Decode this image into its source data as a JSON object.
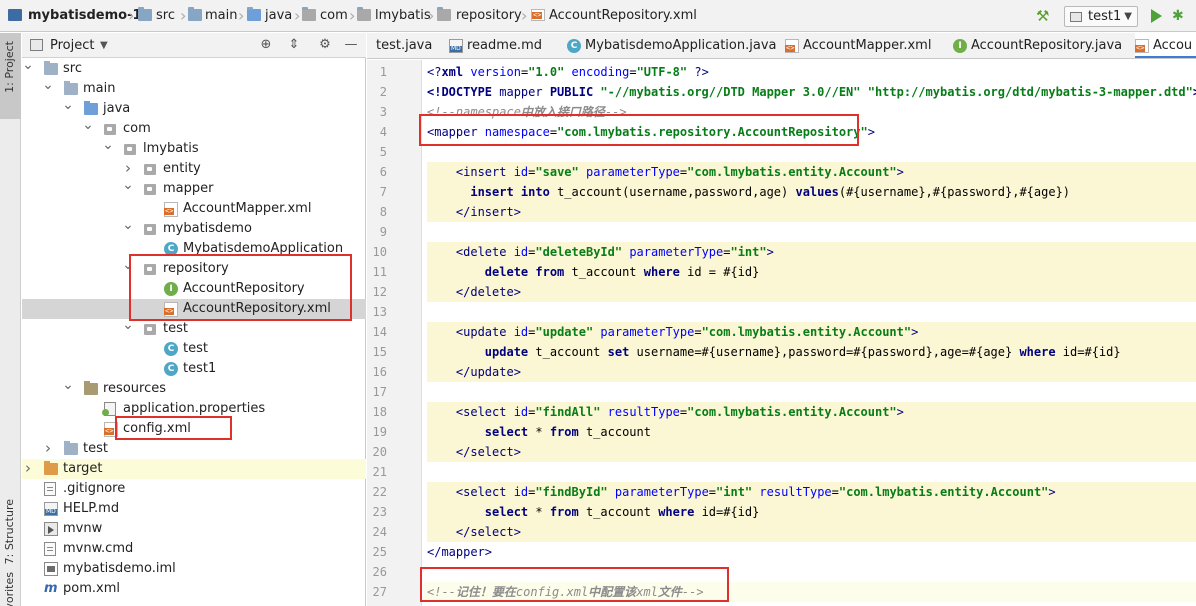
{
  "navbar": {
    "crumbs": [
      "mybatisdemo-1",
      "src",
      "main",
      "java",
      "com",
      "lmybatis",
      "repository",
      "AccountRepository.xml"
    ],
    "run_config": "test1"
  },
  "toolstrip": {
    "project": "1: Project",
    "structure": "7: Structure",
    "favorites": "Favorites"
  },
  "project_panel": {
    "title": "Project",
    "tree": [
      {
        "label": "src",
        "icon": "folder-icon",
        "chevron": "expanded"
      },
      {
        "label": "main",
        "icon": "folder-icon",
        "chevron": "expanded"
      },
      {
        "label": "java",
        "icon": "source-folder-icon",
        "chevron": "expanded"
      },
      {
        "label": "com",
        "icon": "package-icon",
        "chevron": "expanded"
      },
      {
        "label": "lmybatis",
        "icon": "package-icon",
        "chevron": "expanded"
      },
      {
        "label": "entity",
        "icon": "package-icon",
        "chevron": "collapsed"
      },
      {
        "label": "mapper",
        "icon": "package-icon",
        "chevron": "expanded"
      },
      {
        "label": "AccountMapper.xml",
        "icon": "xml-file-icon",
        "chevron": "none"
      },
      {
        "label": "mybatisdemo",
        "icon": "package-icon",
        "chevron": "expanded"
      },
      {
        "label": "MybatisdemoApplication",
        "icon": "class-icon",
        "chevron": "none"
      },
      {
        "label": "repository",
        "icon": "package-icon",
        "chevron": "expanded"
      },
      {
        "label": "AccountRepository",
        "icon": "interface-icon",
        "chevron": "none"
      },
      {
        "label": "AccountRepository.xml",
        "icon": "xml-file-icon",
        "chevron": "none"
      },
      {
        "label": "test",
        "icon": "package-icon",
        "chevron": "expanded"
      },
      {
        "label": "test",
        "icon": "class-icon",
        "chevron": "none"
      },
      {
        "label": "test1",
        "icon": "class-icon",
        "chevron": "none"
      },
      {
        "label": "resources",
        "icon": "resources-folder-icon",
        "chevron": "expanded"
      },
      {
        "label": "application.properties",
        "icon": "properties-file-icon",
        "chevron": "none"
      },
      {
        "label": "config.xml",
        "icon": "xml-file-icon",
        "chevron": "none"
      },
      {
        "label": "test",
        "icon": "folder-icon",
        "chevron": "collapsed"
      },
      {
        "label": "target",
        "icon": "target-folder-icon",
        "chevron": "collapsed"
      },
      {
        "label": ".gitignore",
        "icon": "gitignore-file-icon",
        "chevron": "none"
      },
      {
        "label": "HELP.md",
        "icon": "markdown-file-icon",
        "chevron": "none"
      },
      {
        "label": "mvnw",
        "icon": "script-file-icon",
        "chevron": "none"
      },
      {
        "label": "mvnw.cmd",
        "icon": "text-file-icon",
        "chevron": "none"
      },
      {
        "label": "mybatisdemo.iml",
        "icon": "iml-file-icon",
        "chevron": "none"
      },
      {
        "label": "pom.xml",
        "icon": "maven-icon",
        "chevron": "none"
      }
    ]
  },
  "tabs": [
    {
      "label": "test.java",
      "icon": "class-icon"
    },
    {
      "label": "readme.md",
      "icon": "markdown-file-icon"
    },
    {
      "label": "MybatisdemoApplication.java",
      "icon": "class-icon"
    },
    {
      "label": "AccountMapper.xml",
      "icon": "xml-file-icon"
    },
    {
      "label": "AccountRepository.java",
      "icon": "interface-icon"
    },
    {
      "label": "Accou",
      "icon": "xml-file-icon"
    }
  ],
  "editor": {
    "line_numbers": [
      "1",
      "2",
      "3",
      "4",
      "5",
      "6",
      "7",
      "8",
      "9",
      "10",
      "11",
      "12",
      "13",
      "14",
      "15",
      "16",
      "17",
      "18",
      "19",
      "20",
      "21",
      "22",
      "23",
      "24",
      "25",
      "26",
      "27"
    ],
    "lines": [
      [
        [
          "tag",
          "<?"
        ],
        [
          "kw",
          "xml "
        ],
        [
          "attr",
          "version"
        ],
        [
          "plain",
          "="
        ],
        [
          "val",
          "\"1.0\""
        ],
        [
          "plain",
          " "
        ],
        [
          "attr",
          "encoding"
        ],
        [
          "plain",
          "="
        ],
        [
          "val",
          "\"UTF-8\""
        ],
        [
          "plain",
          " "
        ],
        [
          "tag",
          "?>"
        ]
      ],
      [
        [
          "kw",
          "<!DOCTYPE "
        ],
        [
          "tag",
          "mapper "
        ],
        [
          "kw",
          "PUBLIC "
        ],
        [
          "val",
          "\"-//mybatis.org//DTD Mapper 3.0//EN\""
        ],
        [
          "plain",
          " "
        ],
        [
          "val",
          "\"http://mybatis.org/dtd/mybatis-3-mapper.dtd\""
        ],
        [
          "kw",
          ">"
        ]
      ],
      [
        [
          "cmt",
          "<!--namespace"
        ],
        [
          "cmt-b",
          "中放入接口路径"
        ],
        [
          "cmt",
          "-->"
        ]
      ],
      [
        [
          "tag",
          "<mapper "
        ],
        [
          "attr",
          "namespace"
        ],
        [
          "plain",
          "="
        ],
        [
          "val",
          "\"com.lmybatis.repository.AccountRepository\""
        ],
        [
          "tag",
          ">"
        ]
      ],
      [],
      [
        [
          "plain",
          "    "
        ],
        [
          "tag",
          "<insert "
        ],
        [
          "attr",
          "id"
        ],
        [
          "plain",
          "="
        ],
        [
          "val",
          "\"save\""
        ],
        [
          "plain",
          " "
        ],
        [
          "attr",
          "parameterType"
        ],
        [
          "plain",
          "="
        ],
        [
          "val",
          "\"com.lmybatis.entity.Account\""
        ],
        [
          "tag",
          ">"
        ]
      ],
      [
        [
          "plain",
          "      "
        ],
        [
          "kw",
          "insert into "
        ],
        [
          "plain",
          "t_account(username,password,age) "
        ],
        [
          "kw",
          "values"
        ],
        [
          "plain",
          "(#{username},#{password},#{age})"
        ]
      ],
      [
        [
          "plain",
          "    "
        ],
        [
          "tag",
          "</insert>"
        ]
      ],
      [],
      [
        [
          "plain",
          "    "
        ],
        [
          "tag",
          "<delete "
        ],
        [
          "attr",
          "id"
        ],
        [
          "plain",
          "="
        ],
        [
          "val",
          "\"deleteById\""
        ],
        [
          "plain",
          " "
        ],
        [
          "attr",
          "parameterType"
        ],
        [
          "plain",
          "="
        ],
        [
          "val",
          "\"int\""
        ],
        [
          "tag",
          ">"
        ]
      ],
      [
        [
          "plain",
          "        "
        ],
        [
          "kw",
          "delete from "
        ],
        [
          "plain",
          "t_account "
        ],
        [
          "kw",
          "where "
        ],
        [
          "plain",
          "id = #{id}"
        ]
      ],
      [
        [
          "plain",
          "    "
        ],
        [
          "tag",
          "</delete>"
        ]
      ],
      [],
      [
        [
          "plain",
          "    "
        ],
        [
          "tag",
          "<update "
        ],
        [
          "attr",
          "id"
        ],
        [
          "plain",
          "="
        ],
        [
          "val",
          "\"update\""
        ],
        [
          "plain",
          " "
        ],
        [
          "attr",
          "parameterType"
        ],
        [
          "plain",
          "="
        ],
        [
          "val",
          "\"com.lmybatis.entity.Account\""
        ],
        [
          "tag",
          ">"
        ]
      ],
      [
        [
          "plain",
          "        "
        ],
        [
          "kw",
          "update "
        ],
        [
          "plain",
          "t_account "
        ],
        [
          "kw",
          "set "
        ],
        [
          "plain",
          "username=#{username},password=#{password},age=#{age} "
        ],
        [
          "kw",
          "where "
        ],
        [
          "plain",
          "id=#{id}"
        ]
      ],
      [
        [
          "plain",
          "    "
        ],
        [
          "tag",
          "</update>"
        ]
      ],
      [],
      [
        [
          "plain",
          "    "
        ],
        [
          "tag",
          "<select "
        ],
        [
          "attr",
          "id"
        ],
        [
          "plain",
          "="
        ],
        [
          "val",
          "\"findAll\""
        ],
        [
          "plain",
          " "
        ],
        [
          "attr",
          "resultType"
        ],
        [
          "plain",
          "="
        ],
        [
          "val",
          "\"com.lmybatis.entity.Account\""
        ],
        [
          "tag",
          ">"
        ]
      ],
      [
        [
          "plain",
          "        "
        ],
        [
          "kw",
          "select "
        ],
        [
          "plain",
          "* "
        ],
        [
          "kw",
          "from "
        ],
        [
          "plain",
          "t_account"
        ]
      ],
      [
        [
          "plain",
          "    "
        ],
        [
          "tag",
          "</select>"
        ]
      ],
      [],
      [
        [
          "plain",
          "    "
        ],
        [
          "tag",
          "<select "
        ],
        [
          "attr",
          "id"
        ],
        [
          "plain",
          "="
        ],
        [
          "val",
          "\"findById\""
        ],
        [
          "plain",
          " "
        ],
        [
          "attr",
          "parameterType"
        ],
        [
          "plain",
          "="
        ],
        [
          "val",
          "\"int\""
        ],
        [
          "plain",
          " "
        ],
        [
          "attr",
          "resultType"
        ],
        [
          "plain",
          "="
        ],
        [
          "val",
          "\"com.lmybatis.entity.Account\""
        ],
        [
          "tag",
          ">"
        ]
      ],
      [
        [
          "plain",
          "        "
        ],
        [
          "kw",
          "select "
        ],
        [
          "plain",
          "* "
        ],
        [
          "kw",
          "from "
        ],
        [
          "plain",
          "t_account "
        ],
        [
          "kw",
          "where "
        ],
        [
          "plain",
          "id=#{id}"
        ]
      ],
      [
        [
          "plain",
          "    "
        ],
        [
          "tag",
          "</select>"
        ]
      ],
      [
        [
          "tag",
          "</mapper>"
        ]
      ],
      [],
      [
        [
          "cmt",
          "<!--"
        ],
        [
          "cmt-b",
          "记住！要在"
        ],
        [
          "cmt",
          "config.xml"
        ],
        [
          "cmt-b",
          "中配置该"
        ],
        [
          "cmt",
          "xml"
        ],
        [
          "cmt-b",
          "文件"
        ],
        [
          "cmt",
          "-->"
        ]
      ]
    ]
  },
  "colors": {
    "highlight_box": "#e0302b",
    "selection": "#d5d5d5",
    "block_highlight": "#fbf6d3"
  }
}
